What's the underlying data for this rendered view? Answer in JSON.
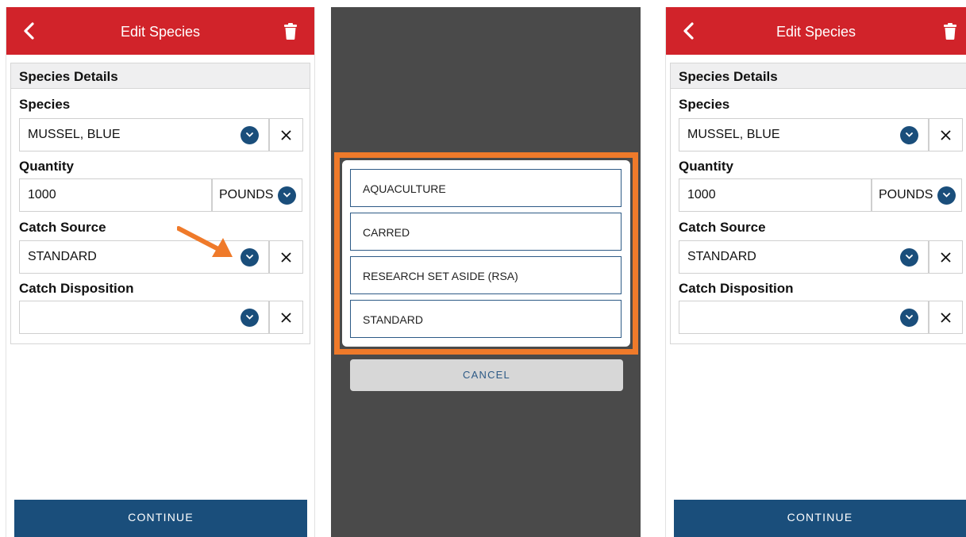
{
  "left_screen": {
    "header": {
      "title": "Edit Species"
    },
    "section_title": "Species Details",
    "species": {
      "label": "Species",
      "value": "MUSSEL, BLUE"
    },
    "quantity": {
      "label": "Quantity",
      "value": "1000",
      "unit": "POUNDS"
    },
    "catch_source": {
      "label": "Catch Source",
      "value": "STANDARD"
    },
    "catch_disposition": {
      "label": "Catch Disposition",
      "value": ""
    },
    "continue_label": "CONTINUE"
  },
  "picker": {
    "options": [
      "AQUACULTURE",
      "CARRED",
      "RESEARCH SET ASIDE (RSA)",
      "STANDARD"
    ],
    "cancel_label": "CANCEL"
  },
  "right_screen": {
    "header": {
      "title": "Edit Species"
    },
    "section_title": "Species Details",
    "species": {
      "label": "Species",
      "value": "MUSSEL, BLUE"
    },
    "quantity": {
      "label": "Quantity",
      "value": "1000",
      "unit": "POUNDS"
    },
    "catch_source": {
      "label": "Catch Source",
      "value": "STANDARD"
    },
    "catch_disposition": {
      "label": "Catch Disposition",
      "value": ""
    },
    "continue_label": "CONTINUE"
  },
  "colors": {
    "header_red": "#d1232a",
    "primary_blue": "#1a4e7b",
    "highlight_orange": "#ef7a2a",
    "overlay_gray": "#4a4a4a"
  },
  "icons": [
    "back-chevron-icon",
    "trash-icon",
    "chevron-down-icon",
    "close-icon",
    "pointer-arrow-icon"
  ]
}
